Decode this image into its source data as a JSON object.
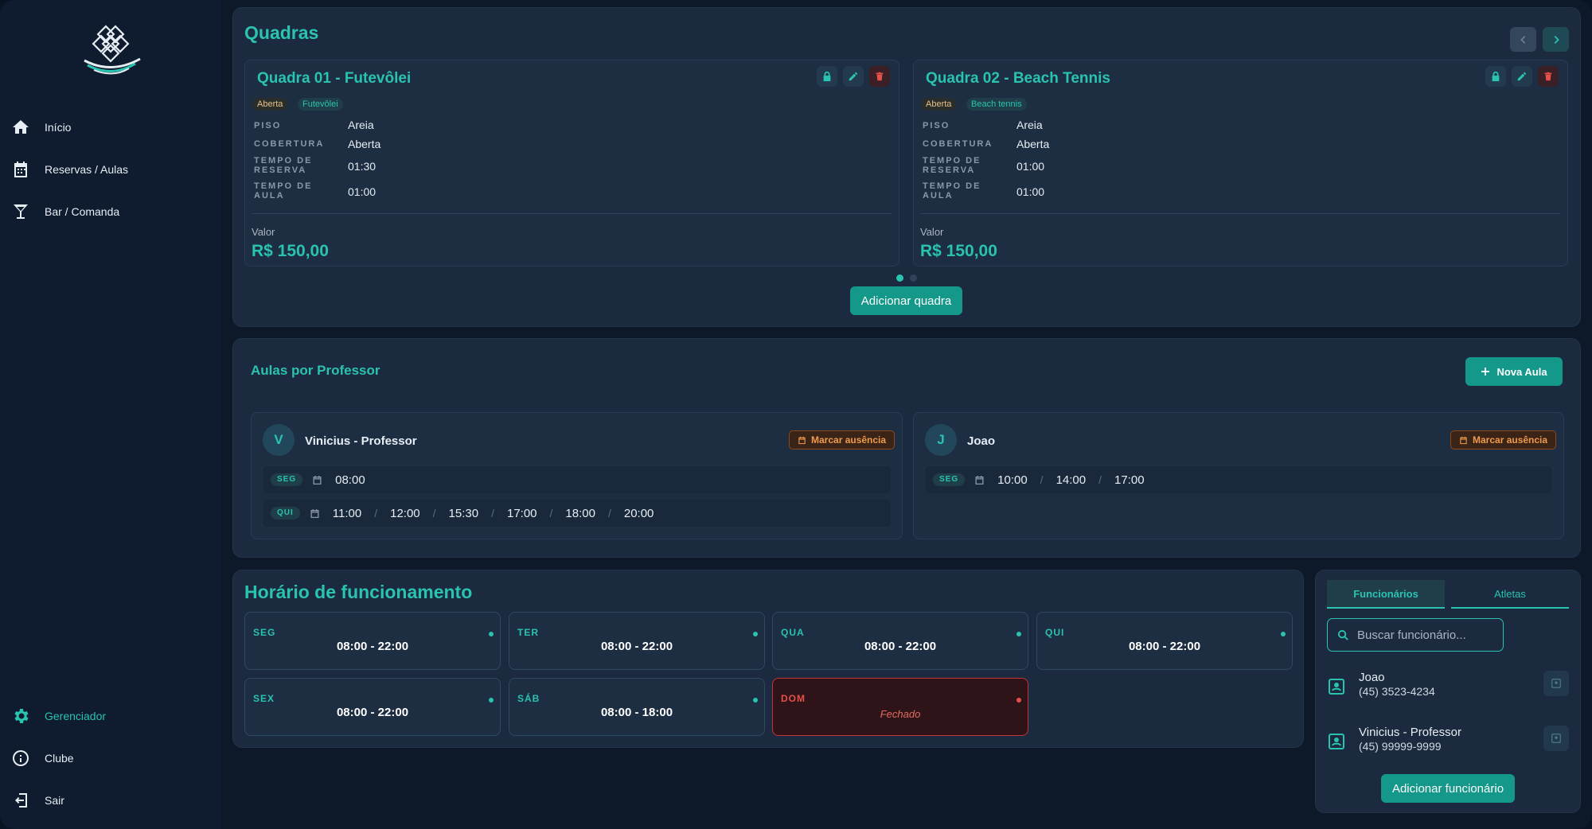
{
  "sidebar": {
    "nav_top": [
      {
        "label": "Início",
        "icon": "home-icon"
      },
      {
        "label": "Reservas / Aulas",
        "icon": "calendar-icon"
      },
      {
        "label": "Bar / Comanda",
        "icon": "cocktail-icon"
      }
    ],
    "nav_bottom": [
      {
        "label": "Gerenciador",
        "icon": "gear-icon",
        "active": true
      },
      {
        "label": "Clube",
        "icon": "info-icon"
      },
      {
        "label": "Sair",
        "icon": "logout-icon"
      }
    ]
  },
  "courts": {
    "title": "Quadras",
    "items": [
      {
        "name": "Quadra 01 - Futevôlei",
        "status": "Aberta",
        "sport": "Futevôlei",
        "specs": [
          {
            "label": "PISO",
            "value": "Areia"
          },
          {
            "label": "COBERTURA",
            "value": "Aberta"
          },
          {
            "label": "TEMPO DE RESERVA",
            "value": "01:30"
          },
          {
            "label": "TEMPO DE AULA",
            "value": "01:00"
          }
        ],
        "price_label": "Valor",
        "price": "R$ 150,00"
      },
      {
        "name": "Quadra 02 - Beach Tennis",
        "status": "Aberta",
        "sport": "Beach tennis",
        "specs": [
          {
            "label": "PISO",
            "value": "Areia"
          },
          {
            "label": "COBERTURA",
            "value": "Aberta"
          },
          {
            "label": "TEMPO DE RESERVA",
            "value": "01:00"
          },
          {
            "label": "TEMPO DE AULA",
            "value": "01:00"
          }
        ],
        "price_label": "Valor",
        "price": "R$ 150,00"
      }
    ],
    "page_dots": 2,
    "active_page": 1,
    "add_label": "Adicionar quadra"
  },
  "lessons": {
    "title": "Aulas por Professor",
    "new_label": "Nova Aula",
    "absence_label": "Marcar ausência",
    "teachers": [
      {
        "initial": "V",
        "name": "Vinicius - Professor",
        "rows": [
          {
            "day": "SEG",
            "times": [
              "08:00"
            ]
          },
          {
            "day": "QUI",
            "times": [
              "11:00",
              "12:00",
              "15:30",
              "17:00",
              "18:00",
              "20:00"
            ]
          }
        ]
      },
      {
        "initial": "J",
        "name": "Joao",
        "rows": [
          {
            "day": "SEG",
            "times": [
              "10:00",
              "14:00",
              "17:00"
            ]
          }
        ]
      }
    ]
  },
  "hours": {
    "title": "Horário de funcionamento",
    "days": [
      {
        "day": "SEG",
        "open": "08:00",
        "close": "22:00",
        "closed": false
      },
      {
        "day": "TER",
        "open": "08:00",
        "close": "22:00",
        "closed": false
      },
      {
        "day": "QUA",
        "open": "08:00",
        "close": "22:00",
        "closed": false
      },
      {
        "day": "QUI",
        "open": "08:00",
        "close": "22:00",
        "closed": false
      },
      {
        "day": "SEX",
        "open": "08:00",
        "close": "22:00",
        "closed": false
      },
      {
        "day": "SÁB",
        "open": "08:00",
        "close": "18:00",
        "closed": false
      },
      {
        "day": "DOM",
        "closed": true,
        "closed_label": "Fechado"
      }
    ],
    "range_sep": "-"
  },
  "staff": {
    "tabs": [
      {
        "label": "Funcionários",
        "active": true
      },
      {
        "label": "Atletas",
        "active": false
      }
    ],
    "search_placeholder": "Buscar funcionário...",
    "members": [
      {
        "name": "Joao",
        "phone": "(45) 3523-4234"
      },
      {
        "name": "Vinicius - Professor",
        "phone": "(45) 99999-9999"
      }
    ],
    "add_label": "Adicionar funcionário"
  },
  "colors": {
    "accent": "#2ac3b0",
    "primary_button": "#14988a",
    "danger": "#e4514a",
    "warning": "#f09a4a",
    "panel": "#1b2a3e",
    "background": "#0d1828"
  }
}
